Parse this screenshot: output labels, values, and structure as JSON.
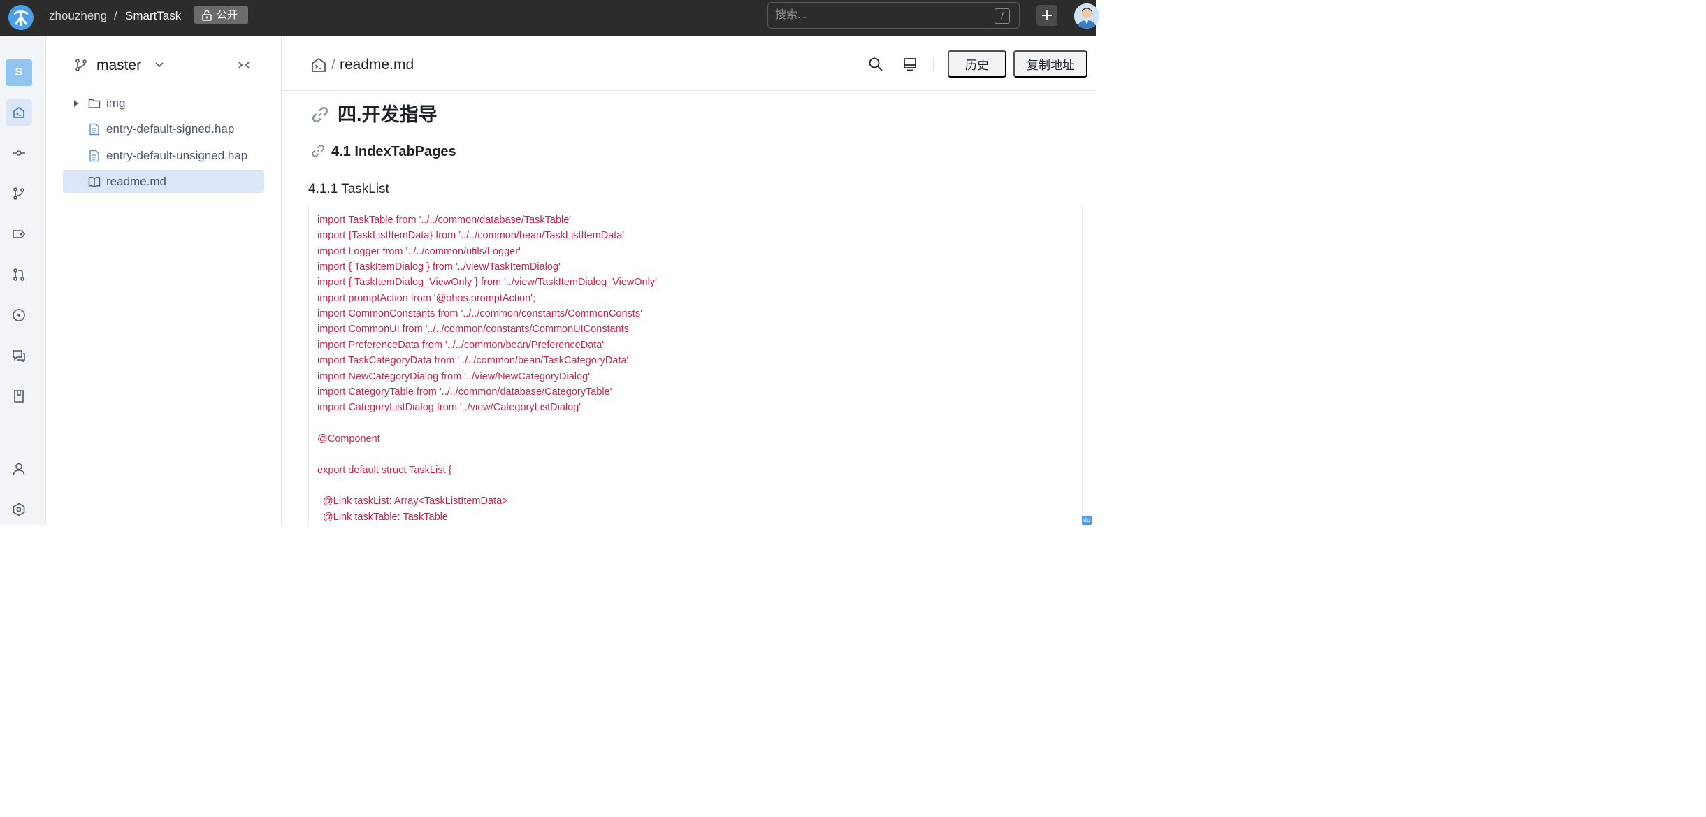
{
  "header": {
    "owner": "zhouzheng",
    "separator": "/",
    "repo": "SmartTask",
    "visibility": "公开",
    "search": {
      "placeholder": "搜索...",
      "shortcut": "/"
    }
  },
  "rail": {
    "project_initial": "S",
    "items": [
      "code-icon",
      "commit-icon",
      "branch-icon",
      "tag-icon",
      "pull-request-icon",
      "issue-icon",
      "discussion-icon",
      "wiki-icon",
      "user-icon",
      "settings-icon"
    ]
  },
  "tree": {
    "branch": "master",
    "files": [
      {
        "name": "img",
        "type": "folder",
        "icon": "folder-icon"
      },
      {
        "name": "entry-default-signed.hap",
        "type": "file",
        "icon": "file-icon"
      },
      {
        "name": "entry-default-unsigned.hap",
        "type": "file",
        "icon": "file-icon"
      },
      {
        "name": "readme.md",
        "type": "file",
        "icon": "book-icon",
        "selected": true
      }
    ]
  },
  "main": {
    "path_sep": "/",
    "file": "readme.md",
    "history_button": "历史",
    "copy_button": "复制地址"
  },
  "readme": {
    "h1": "四.开发指导",
    "h2": "4.1 IndexTabPages",
    "h3": "4.1.1 TaskList",
    "code": [
      "import TaskTable from '../../common/database/TaskTable'",
      "import {TaskListItemData} from '../../common/bean/TaskListItemData'",
      "import Logger from '../../common/utils/Logger'",
      "import { TaskItemDialog } from '../view/TaskItemDialog'",
      "import { TaskItemDialog_ViewOnly } from '../view/TaskItemDialog_ViewOnly'",
      "import promptAction from '@ohos.promptAction';",
      "import CommonConstants from '../../common/constants/CommonConsts'",
      "import CommonUI from '../../common/constants/CommonUIConstants'",
      "import PreferenceData from '../../common/bean/PreferenceData'",
      "import TaskCategoryData from '../../common/bean/TaskCategoryData'",
      "import NewCategoryDialog from '../view/NewCategoryDialog'",
      "import CategoryTable from '../../common/database/CategoryTable'",
      "import CategoryListDialog from '../view/CategoryListDialog'",
      "",
      "@Component",
      "",
      "export default struct TaskList {",
      "",
      "  @Link taskList: Array<TaskListItemData>",
      "  @Link taskTable: TaskTable"
    ]
  },
  "corner_badge": "du",
  "colors": {
    "topbar": "#2c2c2c",
    "accent": "#4a9fe8",
    "code_text": "#c7254e",
    "selected_row": "#dbe6f8"
  }
}
